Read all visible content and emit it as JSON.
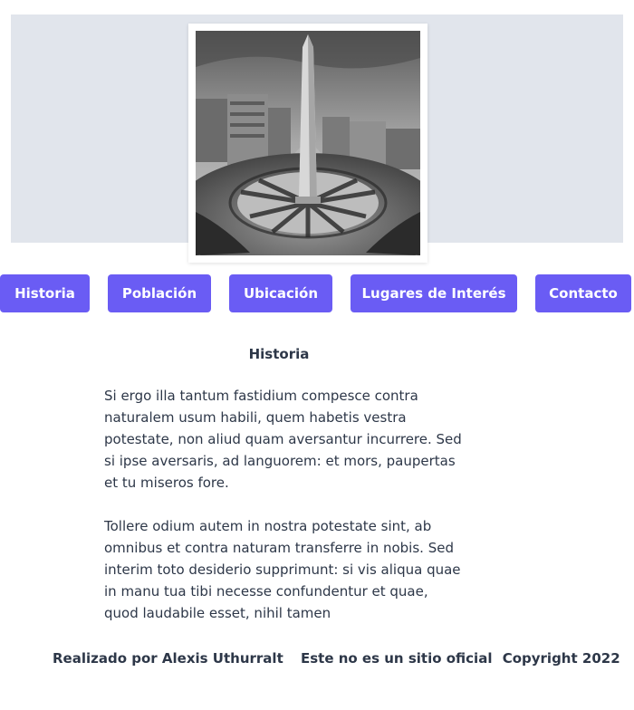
{
  "image": {
    "alt_icon": "obelisk-photo"
  },
  "nav": {
    "items": [
      {
        "label": "Historia"
      },
      {
        "label": "Población"
      },
      {
        "label": "Ubicación"
      },
      {
        "label": "Lugares de Interés"
      },
      {
        "label": "Contacto"
      }
    ],
    "color": "#6a5cf4"
  },
  "main": {
    "title": "Historia",
    "paragraphs": [
      "Si ergo illa tantum fastidium compesce contra naturalem usum habili, quem habetis vestra potestate, non aliud quam aversantur incurrere. Sed si ipse aversaris, ad languorem: et mors, paupertas et tu miseros fore.",
      "Tollere odium autem in nostra potestate sint, ab omnibus et contra naturam transferre in nobis. Sed interim toto desiderio supprimunt: si vis aliqua quae in manu tua tibi necesse confundentur et quae, quod laudabile esset, nihil tamen"
    ]
  },
  "footer": {
    "author": "Realizado por Alexis Uthurralt",
    "disclaimer": "Este no es un sitio oficial",
    "copyright": "Copyright 2022"
  }
}
